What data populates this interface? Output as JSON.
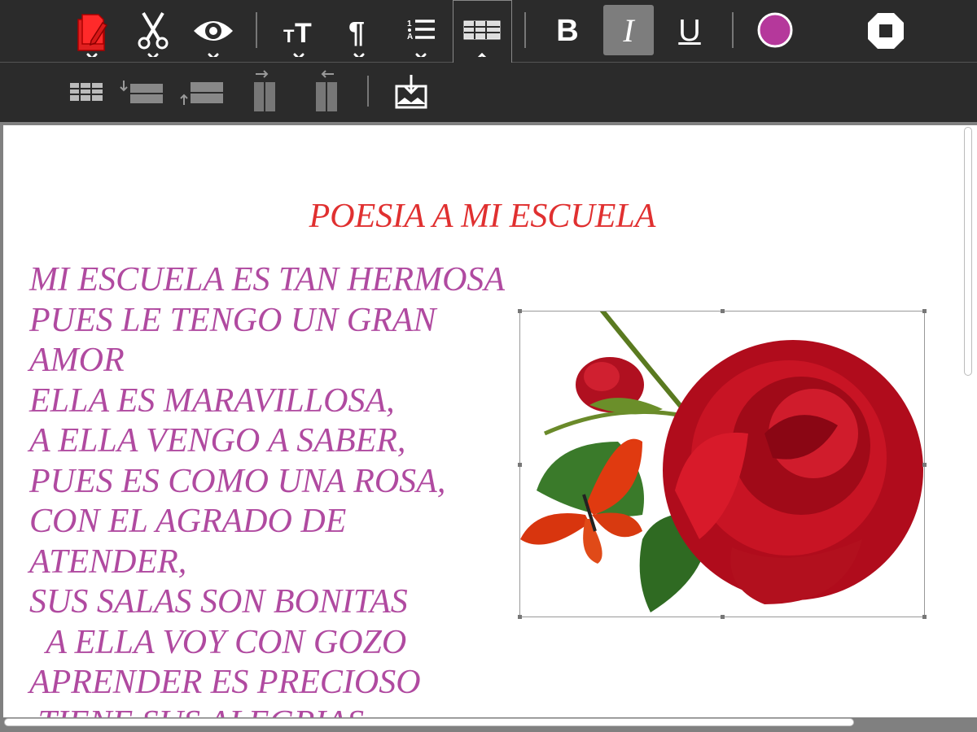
{
  "toolbar": {
    "buttons": [
      {
        "name": "paste",
        "icon": "paste-icon"
      },
      {
        "name": "cut",
        "icon": "scissors-icon"
      },
      {
        "name": "view",
        "icon": "eye-icon"
      },
      {
        "name": "font-size",
        "icon": "font-size-icon"
      },
      {
        "name": "paragraph",
        "icon": "pilcrow-icon"
      },
      {
        "name": "list",
        "icon": "numbered-list-icon"
      },
      {
        "name": "table",
        "icon": "table-icon",
        "active": true
      },
      {
        "name": "bold",
        "label": "B"
      },
      {
        "name": "italic",
        "label": "I",
        "active": true
      },
      {
        "name": "underline",
        "label": "U"
      },
      {
        "name": "color",
        "icon": "color-swatch-icon",
        "color": "#b5389b"
      },
      {
        "name": "stop",
        "icon": "stop-icon"
      }
    ],
    "bold_label": "B",
    "italic_label": "I",
    "underline_label": "U",
    "text_color": "#b5389b"
  },
  "table_toolbar": {
    "buttons": [
      {
        "icon": "insert-table-icon"
      },
      {
        "icon": "insert-row-below-icon"
      },
      {
        "icon": "insert-row-above-icon"
      },
      {
        "icon": "insert-column-right-icon"
      },
      {
        "icon": "insert-column-left-icon"
      },
      {
        "icon": "save-document-icon"
      }
    ]
  },
  "document": {
    "title": "POESIA A MI ESCUELA",
    "title_color": "#e03030",
    "poem_color": "#b04aa0",
    "lines": [
      "MI ESCUELA ES TAN HERMOSA",
      "PUES LE TENGO UN GRAN",
      "AMOR",
      "ELLA ES MARAVILLOSA,",
      "A ELLA VENGO A SABER,",
      "PUES ES COMO UNA ROSA,",
      "CON EL AGRADO DE",
      "ATENDER,",
      "SUS SALAS SON BONITAS",
      "  A ELLA VOY CON GOZO",
      "APRENDER ES PRECIOSO",
      " TIENE SUS ALEGRIAS"
    ],
    "image": {
      "description_icon": "rose-butterfly-image"
    }
  }
}
